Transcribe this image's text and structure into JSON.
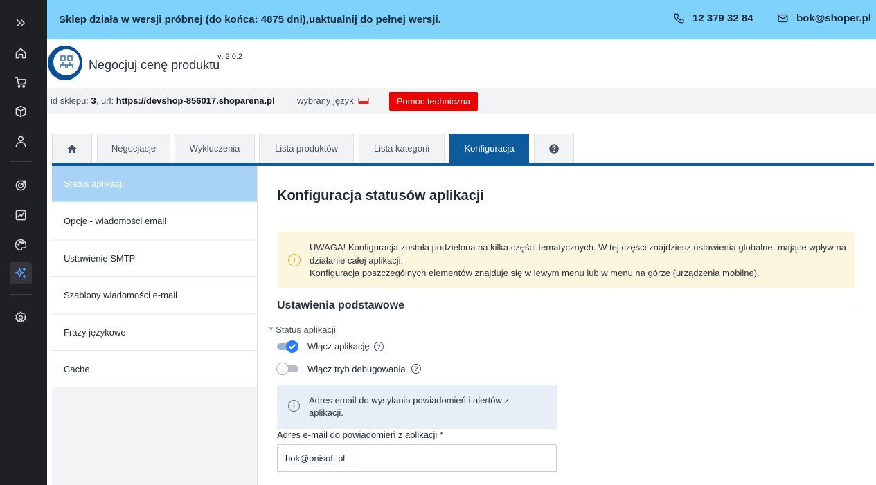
{
  "banner": {
    "text_prefix": "Sklep działa w wersji próbnej (do końca: 4875 dni), ",
    "upgrade_link": "uaktualnij do pełnej wersji",
    "text_suffix": ".",
    "phone": "12 379 32 84",
    "email": "bok@shoper.pl"
  },
  "rail": {
    "items": [
      {
        "icon": "expand-icon"
      },
      {
        "icon": "home-icon"
      },
      {
        "icon": "cart-icon"
      },
      {
        "icon": "box-icon"
      },
      {
        "icon": "user-icon"
      },
      {
        "icon": "target-icon"
      },
      {
        "icon": "chart-icon"
      },
      {
        "icon": "palette-icon"
      },
      {
        "icon": "sparkle-icon",
        "active": true
      },
      {
        "icon": "gear-icon"
      }
    ]
  },
  "app": {
    "title": "Negocjuj cenę produktu",
    "version": "v: 2.0.2"
  },
  "shop": {
    "id_label": "id sklepu: ",
    "id_value": "3",
    "url_label": ", url: ",
    "url_value": "https://devshop-856017.shoparena.pl",
    "lang_label": "wybrany język:",
    "help_button": "Pomoc techniczna"
  },
  "tabs": [
    {
      "label": "",
      "icon": "home-icon"
    },
    {
      "label": "Negocjacje"
    },
    {
      "label": "Wykluczenia"
    },
    {
      "label": "Lista produktów"
    },
    {
      "label": "Lista kategorii"
    },
    {
      "label": "Konfiguracja",
      "active": true
    },
    {
      "label": "",
      "icon": "help-icon"
    }
  ],
  "menu": {
    "items": [
      {
        "label": "Status aplikacji",
        "active": true
      },
      {
        "label": "Opcje - wiadomości email"
      },
      {
        "label": "Ustawienie SMTP"
      },
      {
        "label": "Szablony wiadomości e-mail"
      },
      {
        "label": "Frazy językowe"
      },
      {
        "label": "Cache"
      }
    ]
  },
  "main": {
    "title": "Konfiguracja statusów aplikacji",
    "warning": {
      "line1": "UWAGA! Konfiguracja została podzielona na kilka części tematycznych. W tej części znajdziesz ustawienia globalne, mające wpływ na",
      "line2": "działanie całej aplikacji.",
      "line3": "Konfiguracja poszczególnych elementów znajduje się w lewym menu lub w menu na górze (urządzenia mobilne)."
    },
    "section_title": "Ustawienia podstawowe",
    "status_label": "Status aplikacji",
    "required_mark": "*",
    "toggle_app": {
      "label": "Włącz aplikację",
      "checked": true
    },
    "toggle_debug": {
      "label": "Włącz tryb debugowania",
      "checked": false
    },
    "info_text": "Adres email do wysyłania powiadomień i alertów z aplikacji.",
    "email_label": "Adres e-mail do powiadomień z aplikacji *",
    "email_value": "bok@onisoft.pl"
  },
  "colors": {
    "banner": "#7fd2fb",
    "rail": "#1f2023",
    "accent": "#0d5a9c",
    "help_button": "#ee0000",
    "warning_bg": "#fdf6df",
    "info_bg": "#e8eef8"
  }
}
